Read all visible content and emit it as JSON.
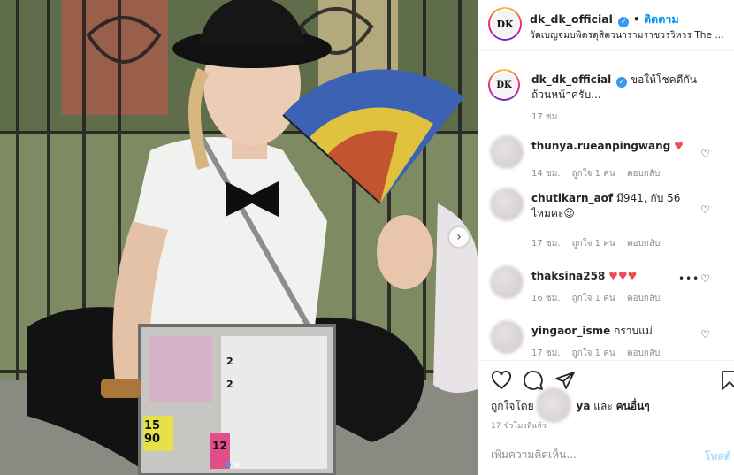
{
  "header": {
    "avatar_initials": "DK",
    "username": "dk_dk_official",
    "verified_icon": "verified-badge-icon",
    "separator": "•",
    "follow_label": "ติดตาม",
    "location": "วัดเบญจมบพิตรดุสิตวนารามราชวรวิหาร The Marble Temple"
  },
  "caption": {
    "avatar_initials": "DK",
    "username": "dk_dk_official",
    "text": "ขอให้โชคดีกันถ้วนหน้าครับ...",
    "time": "17 ชม."
  },
  "comments": [
    {
      "username": "thunya.rueanpingwang",
      "text": "♥",
      "time": "14 ชม.",
      "likes": "ถูกใจ 1 คน",
      "reply": "ตอบกลับ"
    },
    {
      "username": "chutikarn_aof",
      "text": "มี941, กับ 56 ไหมคะ😍",
      "time": "17 ชม.",
      "likes": "ถูกใจ 1 คน",
      "reply": "ตอบกลับ"
    },
    {
      "username": "thaksina258",
      "text": "♥♥♥",
      "time": "16 ชม.",
      "likes": "ถูกใจ 1 คน",
      "reply": "ตอบกลับ",
      "more": "•••"
    },
    {
      "username": "yingaor_isme",
      "text": "กราบแม่",
      "time": "17 ชม.",
      "likes": "ถูกใจ 1 คน",
      "reply": "ตอบกลับ"
    }
  ],
  "actions": {
    "likes_prefix": "ถูกใจโดย",
    "likes_user_fragment": "ya",
    "likes_and": "และ",
    "likes_others": "คนอื่นๆ",
    "post_time": "17 ชั่วโมงที่แล้ว"
  },
  "comment_box": {
    "placeholder": "เพิ่มความคิดเห็น...",
    "post_label": "โพสต์"
  },
  "photo": {
    "lottery_numbers": [
      "15",
      "90",
      "12",
      "2",
      "2"
    ]
  },
  "colors": {
    "accent": "#0095f6",
    "heart_red": "#ed4956",
    "muted": "#8e8e8e"
  }
}
